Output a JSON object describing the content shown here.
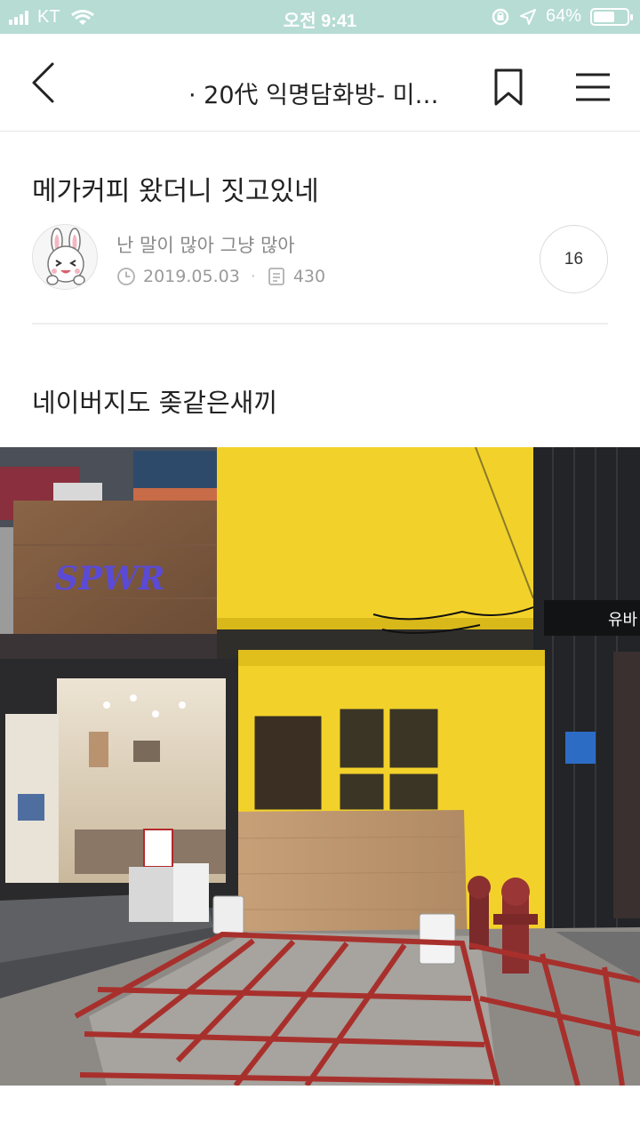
{
  "status_bar": {
    "carrier": "KT",
    "time": "오전 9:41",
    "battery": "64%",
    "battery_level": 0.64
  },
  "nav": {
    "title": "· 20代 익명담화방- 미성...",
    "back_icon": "chevron-left-icon",
    "bookmark_icon": "bookmark-icon",
    "menu_icon": "hamburger-menu-icon"
  },
  "post": {
    "title": "메가커피 왔더니 짓고있네",
    "author": "난 말이 많아 그냥 많아",
    "date": "2019.05.03",
    "views": "430",
    "comment_count": "16",
    "body": "네이버지도 좆같은새끼"
  },
  "colors": {
    "status_bar_bg": "#b6dcd4",
    "storefront_yellow": "#f2d22a"
  }
}
